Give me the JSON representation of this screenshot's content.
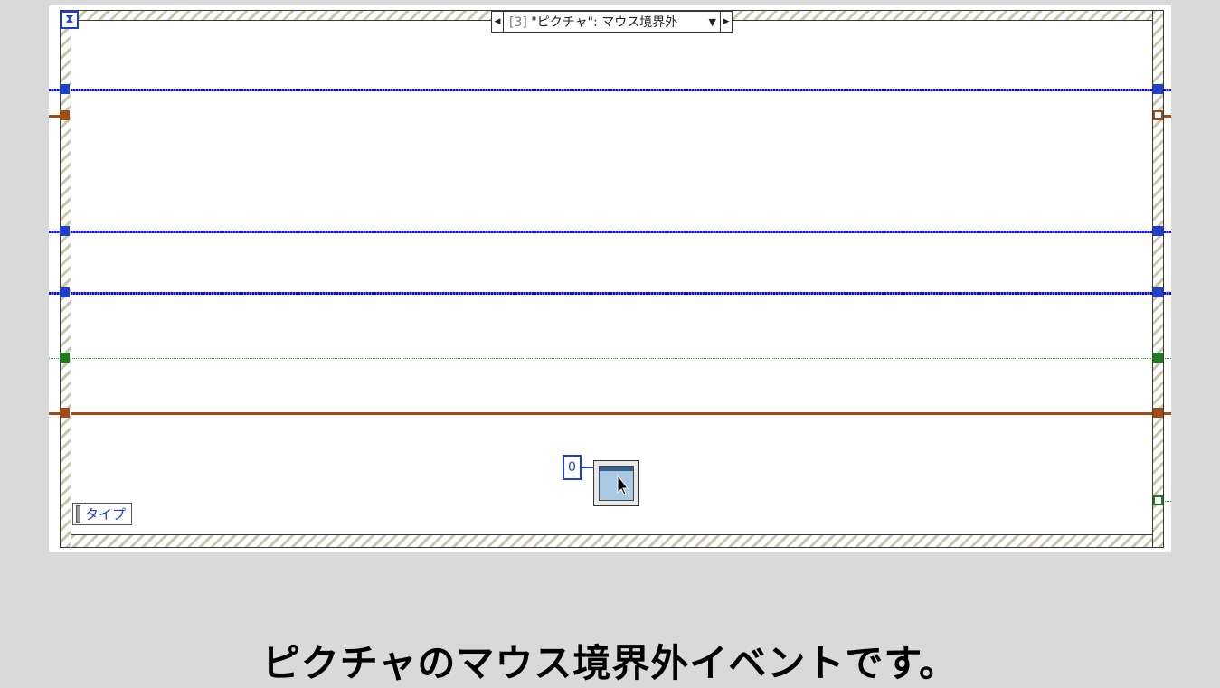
{
  "case_selector": {
    "index": "[3]",
    "label": "\"ピクチャ\": マウス境界外",
    "prev_icon": "triangle-left-icon",
    "next_icon": "triangle-right-icon",
    "dropdown_icon": "triangle-down-icon"
  },
  "event_structure_icon": "hourglass-icon",
  "type_terminal": {
    "label": "タイプ"
  },
  "constant": {
    "value": "0"
  },
  "cursor_node_icon": "window-cursor-icon",
  "caption": "ピクチャのマウス境界外イベントです。",
  "colors": {
    "background": "#d9d9d9",
    "diagram": "#ffffff",
    "wire_blue": "#1f3fcf",
    "wire_orange": "#a04a18",
    "wire_green": "#1e7a1e"
  }
}
